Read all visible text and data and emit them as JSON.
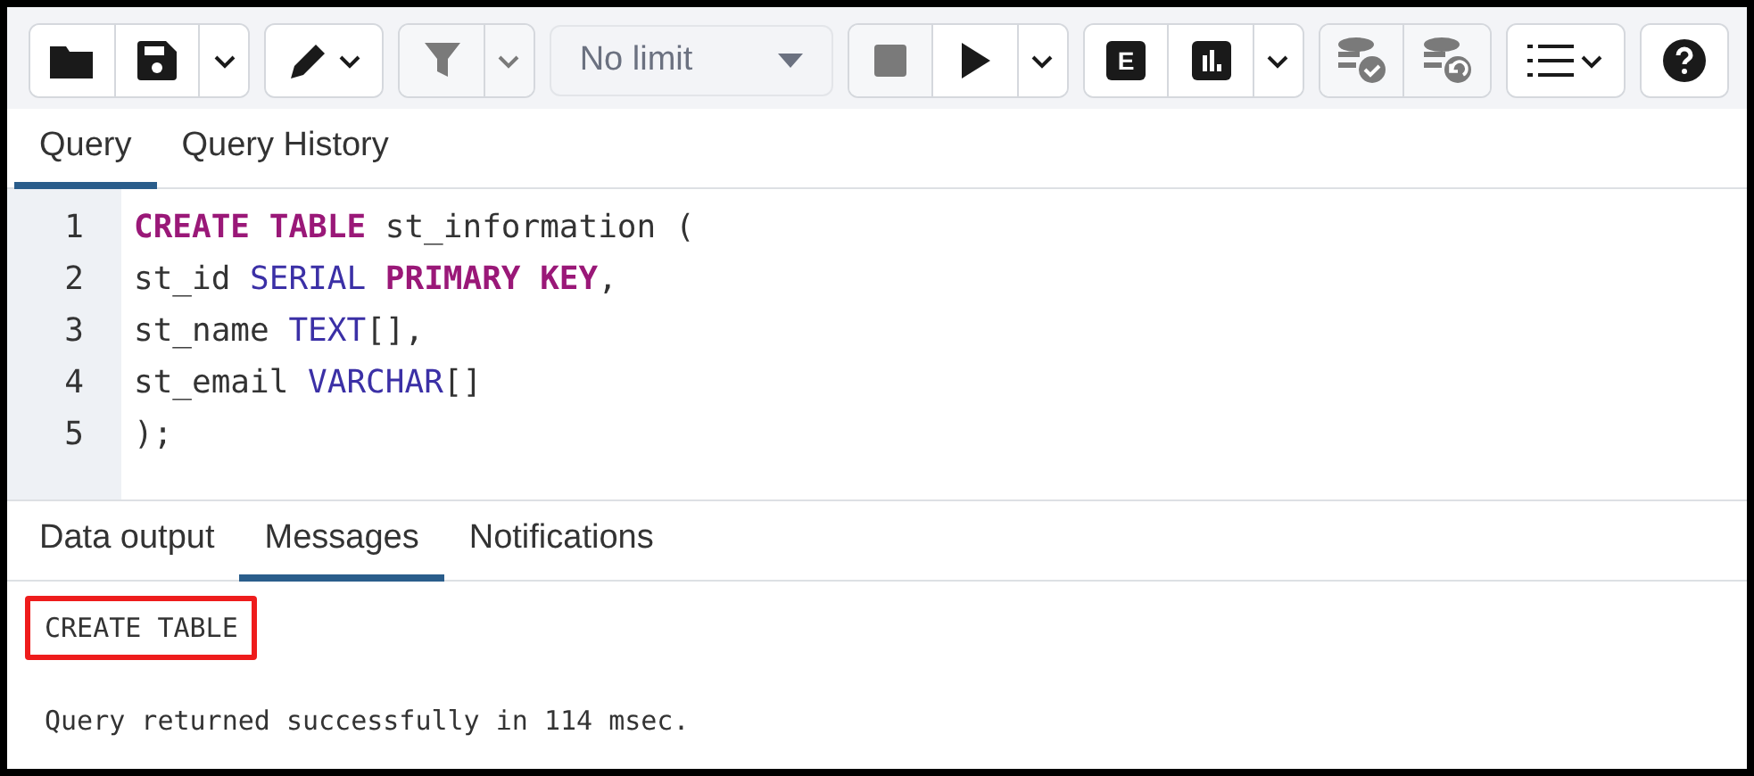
{
  "toolbar": {
    "groups": [
      {
        "buttons": [
          {
            "kind": "folder",
            "disabled": false
          },
          {
            "kind": "save",
            "disabled": false
          },
          {
            "kind": "caret",
            "disabled": false
          }
        ]
      },
      {
        "buttons": [
          {
            "kind": "pencil-caret",
            "disabled": false
          }
        ]
      },
      {
        "buttons": [
          {
            "kind": "filter",
            "disabled": true
          },
          {
            "kind": "caret",
            "disabled": true
          }
        ]
      },
      {
        "select": {
          "value": "No limit",
          "disabled": true
        }
      },
      {
        "buttons": [
          {
            "kind": "stop",
            "disabled": true
          },
          {
            "kind": "play",
            "disabled": false
          },
          {
            "kind": "caret",
            "disabled": false
          }
        ]
      },
      {
        "buttons": [
          {
            "kind": "explain",
            "disabled": false,
            "label": "E"
          },
          {
            "kind": "chart",
            "disabled": false
          },
          {
            "kind": "caret",
            "disabled": false
          }
        ]
      },
      {
        "buttons": [
          {
            "kind": "db-check",
            "disabled": true
          },
          {
            "kind": "db-undo",
            "disabled": true
          }
        ]
      },
      {
        "buttons": [
          {
            "kind": "list-caret",
            "disabled": false
          }
        ]
      },
      {
        "buttons": [
          {
            "kind": "help",
            "disabled": false
          }
        ]
      }
    ]
  },
  "query_tabs": [
    {
      "label": "Query",
      "selected": true
    },
    {
      "label": "Query History",
      "selected": false
    }
  ],
  "editor": {
    "lines": [
      {
        "number": "1",
        "tokens": [
          {
            "kind": "keyword",
            "text": "CREATE TABLE"
          },
          {
            "kind": "plain",
            "text": " st_information ("
          }
        ]
      },
      {
        "number": "2",
        "tokens": [
          {
            "kind": "plain",
            "text": "st_id "
          },
          {
            "kind": "type",
            "text": "SERIAL"
          },
          {
            "kind": "keyword",
            "text": " PRIMARY KEY"
          },
          {
            "kind": "plain",
            "text": ","
          }
        ]
      },
      {
        "number": "3",
        "tokens": [
          {
            "kind": "plain",
            "text": "st_name "
          },
          {
            "kind": "type",
            "text": "TEXT"
          },
          {
            "kind": "plain",
            "text": "[],"
          }
        ]
      },
      {
        "number": "4",
        "tokens": [
          {
            "kind": "plain",
            "text": "st_email "
          },
          {
            "kind": "type",
            "text": "VARCHAR"
          },
          {
            "kind": "plain",
            "text": "[]"
          }
        ]
      },
      {
        "number": "5",
        "tokens": [
          {
            "kind": "plain",
            "text": ");"
          }
        ]
      }
    ]
  },
  "result_tabs": [
    {
      "label": "Data output",
      "selected": false
    },
    {
      "label": "Messages",
      "selected": true
    },
    {
      "label": "Notifications",
      "selected": false
    }
  ],
  "messages": [
    {
      "text": "CREATE TABLE",
      "highlighted": true
    },
    {
      "text": "Query returned successfully in 114 msec.",
      "highlighted": false
    }
  ]
}
